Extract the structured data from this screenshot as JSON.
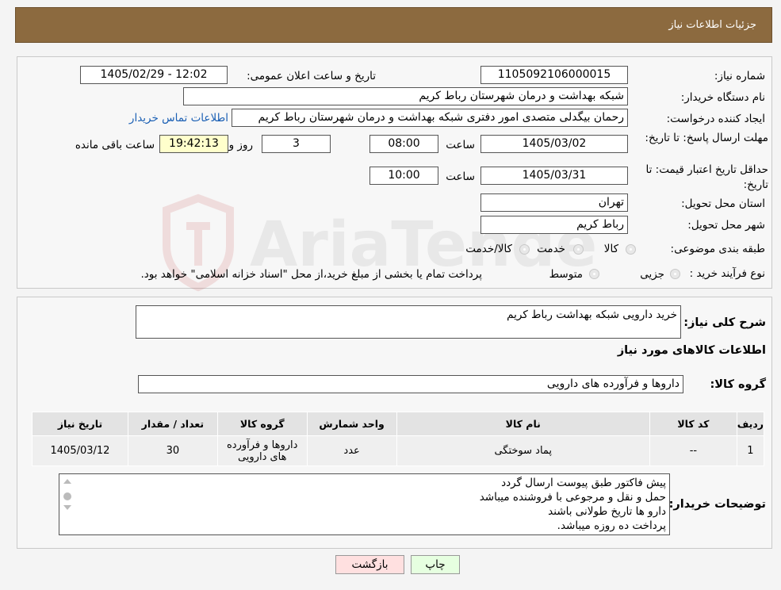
{
  "header": {
    "title": "جزئیات اطلاعات نیاز"
  },
  "need": {
    "number_label": "شماره نیاز:",
    "number_value": "1105092106000015",
    "announce_label": "تاریخ و ساعت اعلان عمومی:",
    "announce_value": "1405/02/29 - 12:02",
    "buyer_label": "نام دستگاه خریدار:",
    "buyer_value": "شبکه بهداشت و درمان شهرستان رباط کریم",
    "creator_label": "ایجاد کننده درخواست:",
    "creator_value": "رحمان بیگدلی متصدی امور دفتری شبکه بهداشت و درمان شهرستان رباط کریم",
    "contact_link": "اطلاعات تماس خریدار",
    "deadline_label": "مهلت ارسال پاسخ: تا تاریخ:",
    "deadline_date": "1405/03/02",
    "time_label": "ساعت",
    "deadline_time": "08:00",
    "days_value": "3",
    "days_label": "روز و",
    "remaining_time": "19:42:13",
    "remaining_label": "ساعت باقی مانده",
    "validity_label": "حداقل تاریخ اعتبار قیمت: تا تاریخ:",
    "validity_date": "1405/03/31",
    "validity_time": "10:00",
    "province_label": "استان محل تحویل:",
    "province_value": "تهران",
    "city_label": "شهر محل تحویل:",
    "city_value": "رباط کریم",
    "category_label": "طبقه بندی موضوعی:",
    "category_options": [
      "کالا",
      "خدمت",
      "کالا/خدمت"
    ],
    "process_label": "نوع فرآیند خرید :",
    "process_options": [
      "جزیی",
      "متوسط"
    ],
    "process_note": "پرداخت تمام یا بخشی از مبلغ خرید،از محل \"اسناد خزانه اسلامی\" خواهد بود."
  },
  "details": {
    "summary_label": "شرح کلی نیاز:",
    "summary_value": "خرید دارویی شبکه بهداشت رباط کریم",
    "goods_info_title": "اطلاعات کالاهای مورد نیاز",
    "goods_group_label": "گروه کالا:",
    "goods_group_value": "داروها و فرآورده های دارویی",
    "table": {
      "headers": [
        "ردیف",
        "کد کالا",
        "نام کالا",
        "واحد شمارش",
        "گروه کالا",
        "تعداد / مقدار",
        "تاریخ نیاز"
      ],
      "rows": [
        [
          "1",
          "--",
          "پماد سوختگی",
          "عدد",
          "داروها و فرآورده های دارویی",
          "30",
          "1405/03/12"
        ]
      ]
    },
    "buyer_notes_label": "توضیحات خریدار:",
    "buyer_notes_lines": [
      "پیش فاکتور طبق پیوست ارسال گردد",
      "حمل و نقل و مرجوعی با فروشنده میباشد",
      "دارو ها تاریخ طولانی باشند",
      "پرداخت ده روزه  میباشد."
    ]
  },
  "buttons": {
    "print": "چاپ",
    "back": "بازگشت"
  },
  "watermark": {
    "text": "AriaTender.neT"
  },
  "colors": {
    "header_bg": "#8c6a3f",
    "link": "#1a5fb4",
    "highlight": "#ffffcc",
    "back_btn": "#ffe0e0",
    "print_btn": "#e6ffe0"
  }
}
